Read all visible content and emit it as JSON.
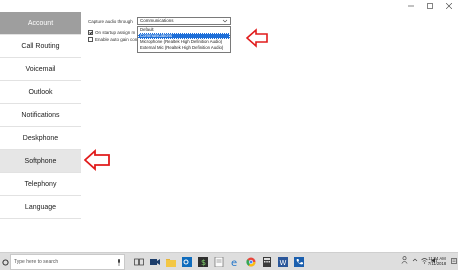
{
  "sidebar": {
    "items": [
      {
        "label": "Account",
        "state": "active"
      },
      {
        "label": "Call Routing",
        "state": ""
      },
      {
        "label": "Voicemail",
        "state": ""
      },
      {
        "label": "Outlook",
        "state": ""
      },
      {
        "label": "Notifications",
        "state": ""
      },
      {
        "label": "Deskphone",
        "state": ""
      },
      {
        "label": "Softphone",
        "state": "hover"
      },
      {
        "label": "Telephony",
        "state": ""
      },
      {
        "label": "Language",
        "state": ""
      }
    ]
  },
  "settings": {
    "capture_label": "Capture audio through",
    "capture_value": "Communications",
    "on_startup_label": "On startup assign m",
    "on_startup_checked": true,
    "auto_gain_label": "Enable auto gain con",
    "auto_gain_checked": false,
    "dropdown_options": [
      {
        "label": "Default",
        "selected": false
      },
      {
        "label": "Communications",
        "selected": true
      },
      {
        "label": "Microphone (Realtek High Definition Audio)",
        "selected": false
      },
      {
        "label": "External Mic (Realtek High Definition Audio)",
        "selected": false
      }
    ]
  },
  "taskbar": {
    "search_placeholder": "Type here to search",
    "clock_time": "11:04 AM",
    "clock_date": "7/11/2018"
  },
  "colors": {
    "accent": "#1e6fd9",
    "annotation_arrow": "#e11b1b",
    "sidebar_active": "#9e9e9e"
  }
}
